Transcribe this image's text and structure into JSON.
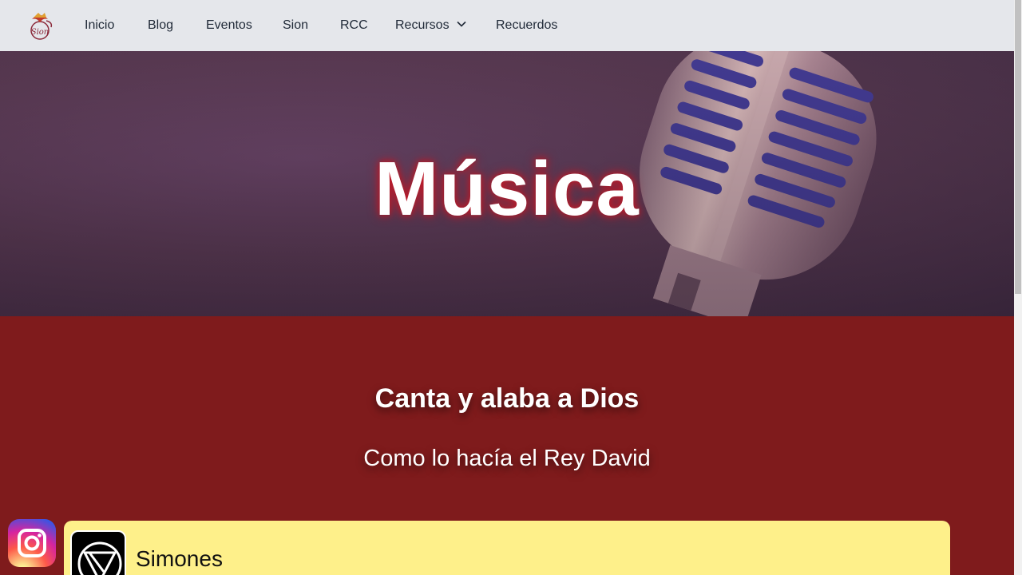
{
  "nav": {
    "logo_text": "Sion",
    "items": [
      {
        "label": "Inicio"
      },
      {
        "label": "Blog"
      },
      {
        "label": "Eventos"
      },
      {
        "label": "Sion"
      },
      {
        "label": "RCC"
      },
      {
        "label": "Recursos"
      },
      {
        "label": "Recuerdos"
      }
    ]
  },
  "hero": {
    "title": "Música"
  },
  "section": {
    "heading": "Canta y alaba a Dios",
    "subheading": "Como lo hacía el Rey David"
  },
  "card": {
    "title": "Simones"
  },
  "colors": {
    "nav_bg": "#e5e7eb",
    "section_bg": "#7f1b1c",
    "card_bg": "#fef08a",
    "title_glow": "#c31a2a"
  },
  "icons": [
    "logo-icon",
    "chevron-down-icon",
    "instagram-icon",
    "simones-logo-icon",
    "microphone-image"
  ]
}
